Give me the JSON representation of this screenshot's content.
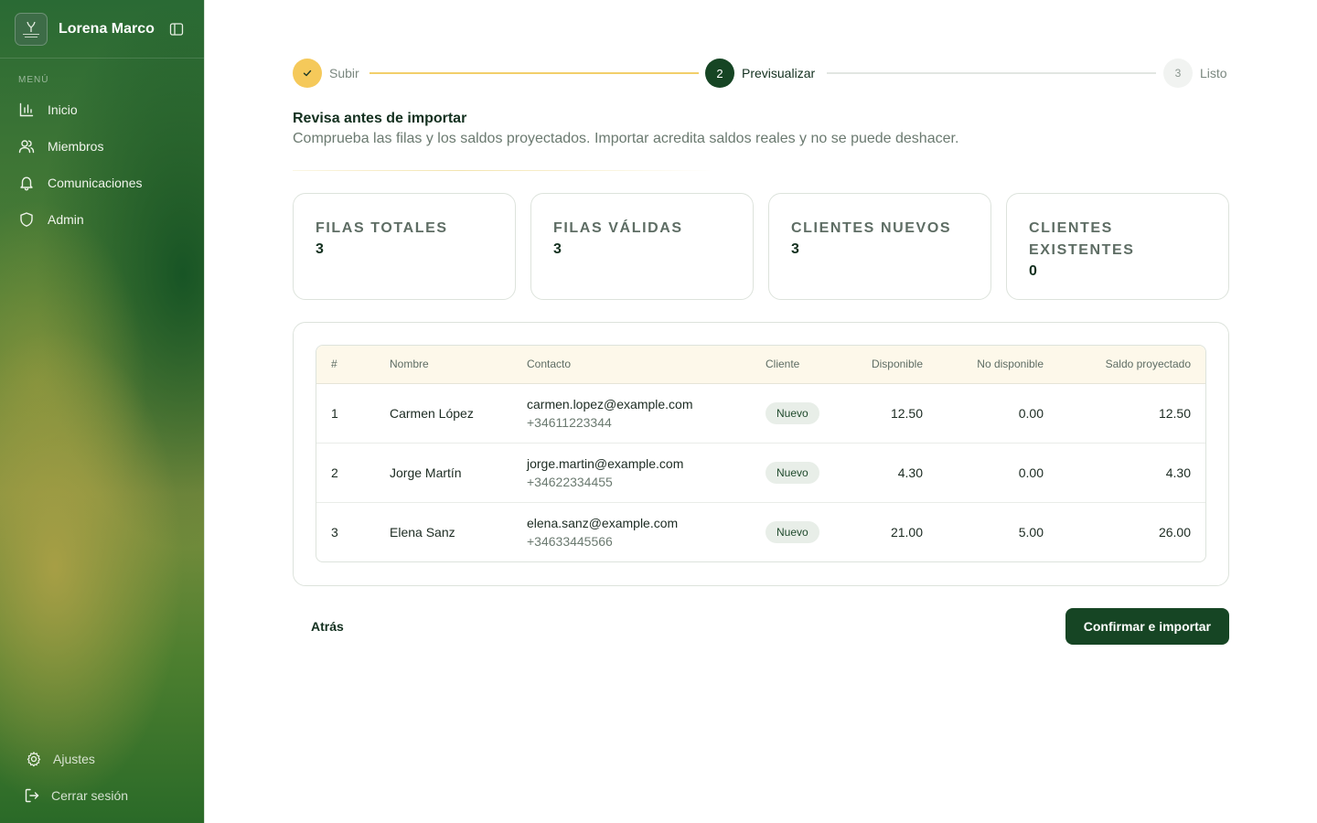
{
  "sidebar": {
    "brand_name": "Lorena Marco",
    "logo_text": "LORENA MARCO",
    "menu_label": "MENÚ",
    "items": [
      {
        "label": "Inicio",
        "icon": "bar-chart-icon"
      },
      {
        "label": "Miembros",
        "icon": "users-icon"
      },
      {
        "label": "Comunicaciones",
        "icon": "bell-icon"
      },
      {
        "label": "Admin",
        "icon": "shield-icon"
      }
    ],
    "bottom": [
      {
        "label": "Ajustes",
        "icon": "gear-icon"
      },
      {
        "label": "Cerrar sesión",
        "icon": "logout-icon"
      }
    ]
  },
  "stepper": {
    "steps": [
      {
        "number": "1",
        "label": "Subir",
        "state": "done"
      },
      {
        "number": "2",
        "label": "Previsualizar",
        "state": "current"
      },
      {
        "number": "3",
        "label": "Listo",
        "state": "pending"
      }
    ]
  },
  "header": {
    "title": "Revisa antes de importar",
    "subtitle": "Comprueba las filas y los saldos proyectados. Importar acredita saldos reales y no se puede deshacer."
  },
  "stats": [
    {
      "label": "FILAS TOTALES",
      "value": "3"
    },
    {
      "label": "FILAS VÁLIDAS",
      "value": "3"
    },
    {
      "label": "CLIENTES NUEVOS",
      "value": "3"
    },
    {
      "label": "CLIENTES EXISTENTES",
      "value": "0"
    }
  ],
  "table": {
    "columns": [
      "#",
      "Nombre",
      "Contacto",
      "Cliente",
      "Disponible",
      "No disponible",
      "Saldo proyectado"
    ],
    "rows": [
      {
        "n": "1",
        "name": "Carmen López",
        "email": "carmen.lopez@example.com",
        "phone": "+34611223344",
        "client": "Nuevo",
        "available": "12.50",
        "unavailable": "0.00",
        "projected": "12.50"
      },
      {
        "n": "2",
        "name": "Jorge Martín",
        "email": "jorge.martin@example.com",
        "phone": "+34622334455",
        "client": "Nuevo",
        "available": "4.30",
        "unavailable": "0.00",
        "projected": "4.30"
      },
      {
        "n": "3",
        "name": "Elena Sanz",
        "email": "elena.sanz@example.com",
        "phone": "+34633445566",
        "client": "Nuevo",
        "available": "21.00",
        "unavailable": "5.00",
        "projected": "26.00"
      }
    ]
  },
  "actions": {
    "back_label": "Atrás",
    "confirm_label": "Confirmar e importar"
  },
  "colors": {
    "primary": "#164524",
    "accent": "#f5c95a",
    "sidebar_green": "#2a6a34"
  }
}
